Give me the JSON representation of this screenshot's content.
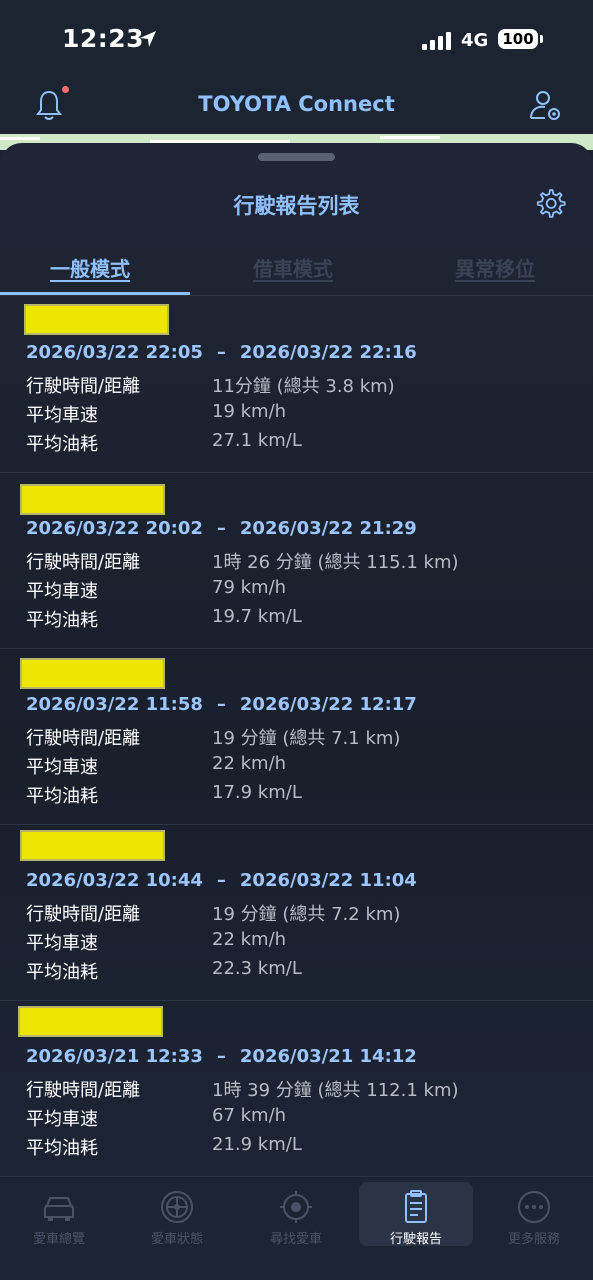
{
  "status_bar": {
    "time": "12:23",
    "network": "4G",
    "battery": "100"
  },
  "header": {
    "title": "TOYOTA Connect"
  },
  "sheet": {
    "title": "行駛報告列表"
  },
  "tabs": [
    {
      "label": "一般模式",
      "active": true
    },
    {
      "label": "借車模式",
      "active": false
    },
    {
      "label": "異常移位",
      "active": false
    }
  ],
  "labels": {
    "duration_distance": "行駛時間/距離",
    "avg_speed": "平均車速",
    "avg_fuel": "平均油耗"
  },
  "trips": [
    {
      "start": "2026/03/22 22:05",
      "end": "2026/03/22 22:16",
      "duration": "11分鐘 (總共 3.8 km)",
      "speed": "19 km/h",
      "fuel": "27.1 km/L"
    },
    {
      "start": "2026/03/22 20:02",
      "end": "2026/03/22 21:29",
      "duration": "1時 26 分鐘 (總共 115.1 km)",
      "speed": "79 km/h",
      "fuel": "19.7 km/L"
    },
    {
      "start": "2026/03/22 11:58",
      "end": "2026/03/22 12:17",
      "duration": "19 分鐘 (總共 7.1 km)",
      "speed": "22 km/h",
      "fuel": "17.9 km/L"
    },
    {
      "start": "2026/03/22 10:44",
      "end": "2026/03/22 11:04",
      "duration": "19 分鐘 (總共 7.2 km)",
      "speed": "22 km/h",
      "fuel": "22.3 km/L"
    },
    {
      "start": "2026/03/21 12:33",
      "end": "2026/03/21 14:12",
      "duration": "1時 39 分鐘 (總共 112.1 km)",
      "speed": "67 km/h",
      "fuel": "21.9 km/L"
    }
  ],
  "dash": "–",
  "bottom_nav": [
    {
      "label": "愛車總覽",
      "icon": "car-icon"
    },
    {
      "label": "愛車狀態",
      "icon": "wheel-icon"
    },
    {
      "label": "尋找愛車",
      "icon": "locate-icon"
    },
    {
      "label": "行駛報告",
      "icon": "report-icon",
      "active": true
    },
    {
      "label": "更多服務",
      "icon": "more-icon"
    }
  ],
  "colors": {
    "accent": "#8fc0ff",
    "highlight": "#ede600",
    "background": "#1b2230"
  }
}
